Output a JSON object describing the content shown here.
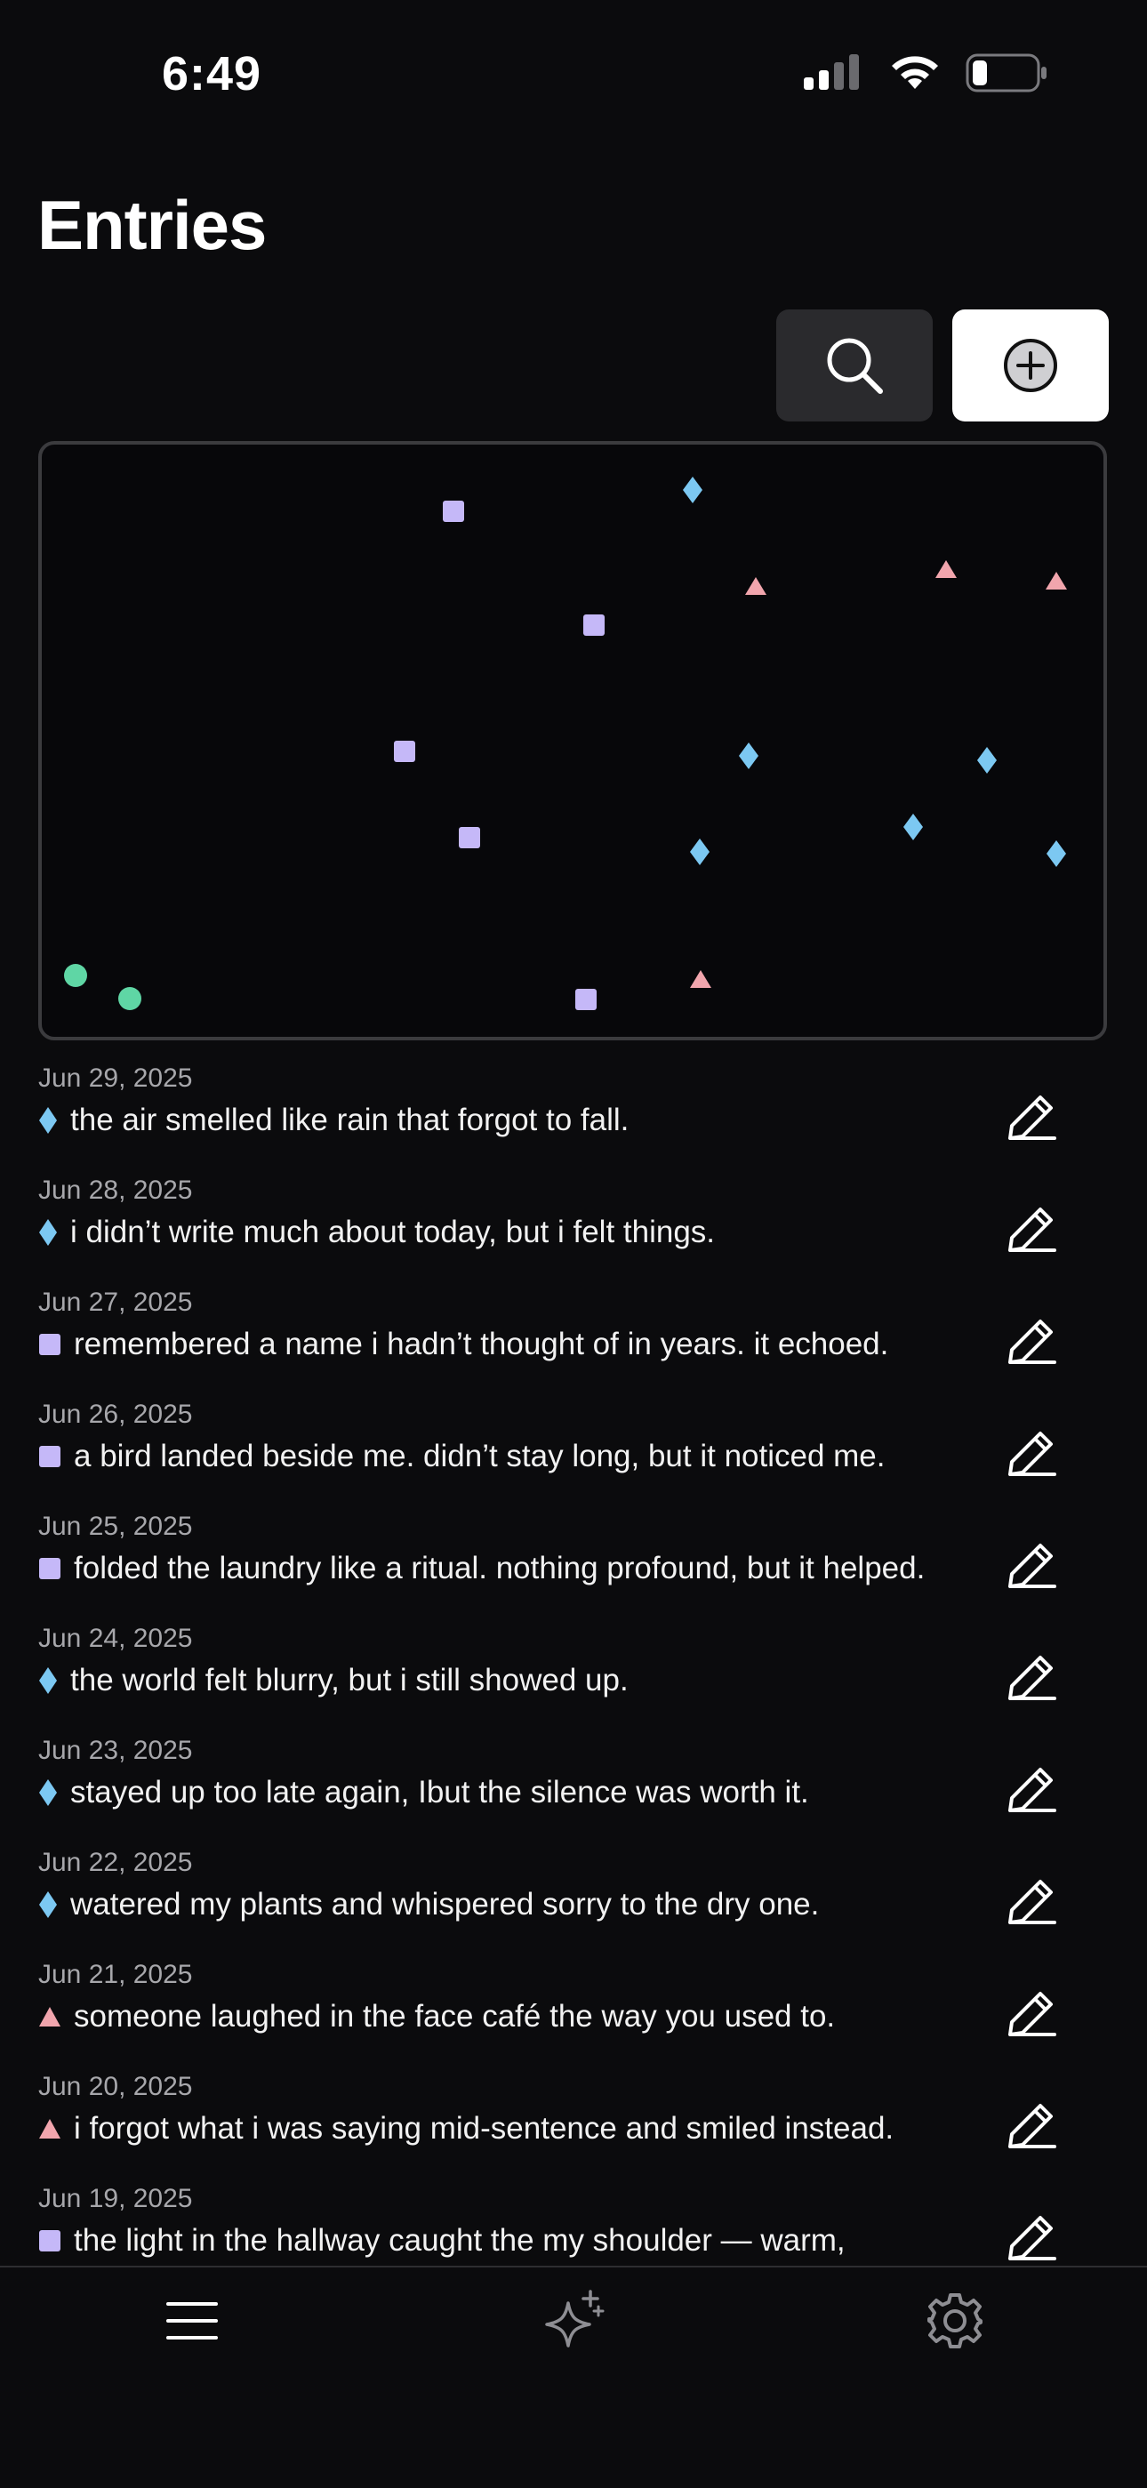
{
  "status": {
    "time": "6:49",
    "icons": [
      "cellular-signal-icon",
      "wifi-icon",
      "battery-icon"
    ]
  },
  "header": {
    "title": "Entries"
  },
  "toolbar": {
    "search_icon": "magnifier-icon",
    "add_icon": "plus-circle-icon"
  },
  "colors": {
    "background": "#0b0b0d",
    "diamond": "#7cc8f2",
    "square": "#c5b8f8",
    "triangle": "#f1a5ad",
    "circle": "#5fd6a5"
  },
  "entries": [
    {
      "date": "Jun 29, 2025",
      "shape": "diamond",
      "text": "the air smelled like rain that forgot to fall."
    },
    {
      "date": "Jun 28, 2025",
      "shape": "diamond",
      "text": "i didn’t write much about today, but i felt things."
    },
    {
      "date": "Jun 27, 2025",
      "shape": "square",
      "text": "remembered a name i hadn’t thought of in years. it echoed."
    },
    {
      "date": "Jun 26, 2025",
      "shape": "square",
      "text": "a bird landed beside me. didn’t stay long, but it noticed me."
    },
    {
      "date": "Jun 25, 2025",
      "shape": "square",
      "text": "folded the laundry like a ritual. nothing profound, but it helped."
    },
    {
      "date": "Jun 24, 2025",
      "shape": "diamond",
      "text": "the world felt blurry, but i still showed up."
    },
    {
      "date": "Jun 23, 2025",
      "shape": "diamond",
      "text": "stayed up too late again, Ibut the silence was worth it."
    },
    {
      "date": "Jun 22, 2025",
      "shape": "diamond",
      "text": "watered my plants and whispered sorry to the dry one."
    },
    {
      "date": "Jun 21, 2025",
      "shape": "triangle",
      "text": "someone laughed in the face café the way you used to."
    },
    {
      "date": "Jun 20, 2025",
      "shape": "triangle",
      "text": "i forgot what i was saying mid-sentence and smiled instead."
    },
    {
      "date": "Jun 19, 2025",
      "shape": "square",
      "text": "the light in the hallway caught the my shoulder — warm,"
    }
  ],
  "tabbar": {
    "items": [
      "menu-icon",
      "sparkle-icon",
      "gear-icon"
    ]
  }
}
